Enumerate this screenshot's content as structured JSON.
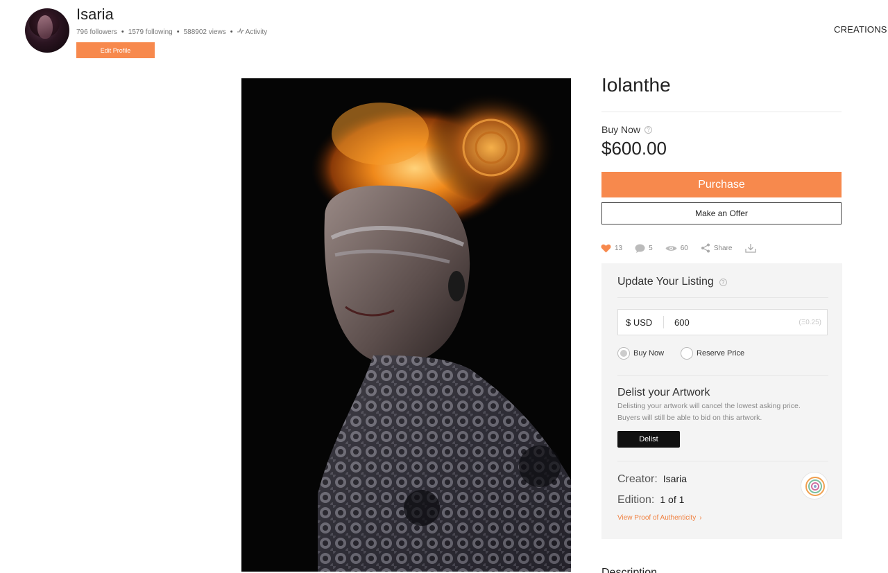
{
  "profile": {
    "username": "Isaria",
    "followers": "796 followers",
    "following": "1579 following",
    "views": "588902 views",
    "activity": "Activity",
    "edit_label": "Edit Profile",
    "separator": "•"
  },
  "nav": {
    "creations": "CREATIONS"
  },
  "artwork": {
    "title": "Iolanthe"
  },
  "sale": {
    "buy_now_label": "Buy Now",
    "help": "?",
    "price": "$600.00",
    "purchase_label": "Purchase",
    "offer_label": "Make an Offer"
  },
  "social": {
    "likes": "13",
    "comments": "5",
    "views": "60",
    "share": "Share",
    "icons": [
      "heart-icon",
      "comment-icon",
      "eye-icon",
      "share-icon",
      "download-icon"
    ]
  },
  "listing": {
    "title": "Update Your Listing",
    "currency": "$ USD",
    "value": "600",
    "eth": "(Ξ0.25)",
    "options": [
      "Buy Now",
      "Reserve Price"
    ],
    "selected": "Buy Now"
  },
  "delist": {
    "title": "Delist your Artwork",
    "description": "Delisting your artwork will cancel the lowest asking price. Buyers will still be able to bid on this artwork.",
    "button": "Delist"
  },
  "meta": {
    "creator_label": "Creator:",
    "creator": "Isaria",
    "edition_label": "Edition:",
    "edition": "1 of 1",
    "proof_link": "View Proof of Authenticity",
    "chevron": "›"
  },
  "description": {
    "heading": "Description"
  },
  "colors": {
    "accent": "#f7894d",
    "dark": "#111111",
    "panel": "#f4f4f4"
  }
}
